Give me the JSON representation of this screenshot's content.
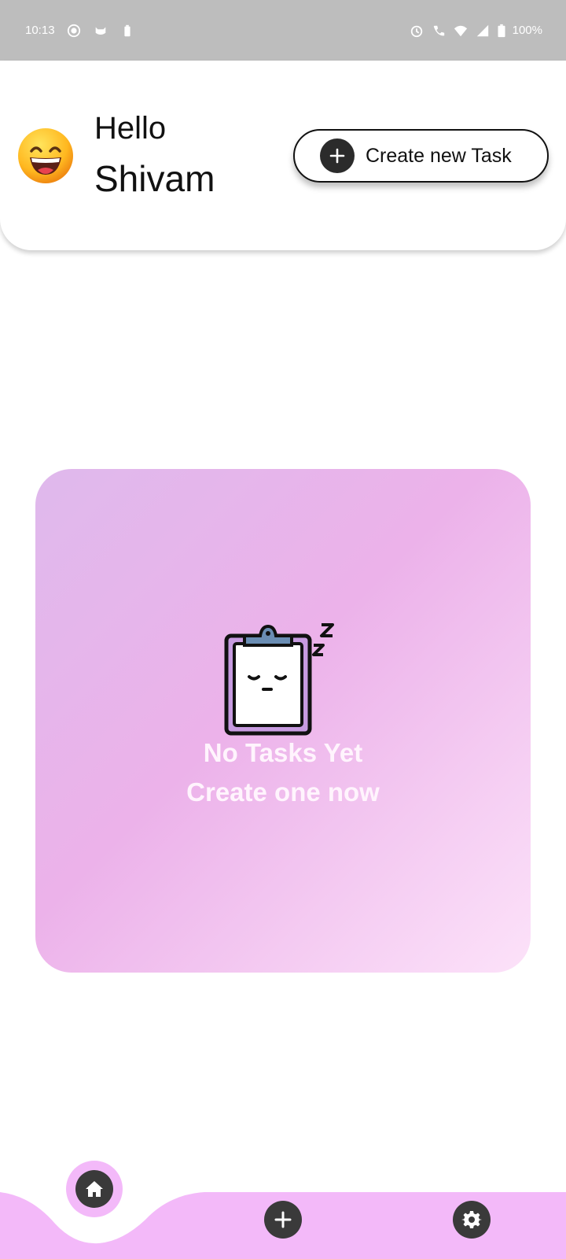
{
  "status_bar": {
    "time": "10:13",
    "battery": "100%",
    "left_icons": [
      "record-icon",
      "cat-icon",
      "battery-saver-icon"
    ],
    "right_icons": [
      "alarm-icon",
      "wifi-call-icon",
      "wifi-icon",
      "signal-icon",
      "battery-icon"
    ]
  },
  "header": {
    "greeting": "Hello",
    "user_name": "Shivam",
    "avatar_icon": "smiling-face-emoji-icon",
    "create_button_label": "Create new Task",
    "create_button_icon": "plus-icon"
  },
  "empty_state": {
    "icon": "sleeping-clipboard-icon",
    "title": "No Tasks Yet",
    "subtitle": "Create one now"
  },
  "bottom_nav": {
    "items": [
      {
        "name": "home",
        "icon": "home-icon",
        "active": true
      },
      {
        "name": "add",
        "icon": "plus-icon",
        "active": false
      },
      {
        "name": "settings",
        "icon": "gear-icon",
        "active": false
      }
    ],
    "background_color": "#f3b9f9"
  },
  "colors": {
    "status_bar": "#bdbdbd",
    "accent_pink": "#f3b9f9",
    "dark_button": "#3a3a3a"
  }
}
